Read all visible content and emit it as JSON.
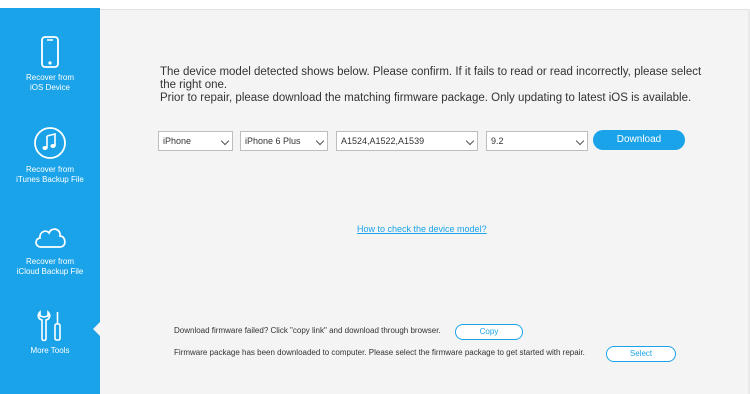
{
  "sidebar": {
    "items": [
      {
        "label_line1": "Recover from",
        "label_line2": "iOS Device",
        "icon": "phone-icon"
      },
      {
        "label_line1": "Recover from",
        "label_line2": "iTunes Backup File",
        "icon": "music-note-icon"
      },
      {
        "label_line1": "Recover from",
        "label_line2": "iCloud Backup File",
        "icon": "cloud-icon"
      },
      {
        "label_line1": "More Tools",
        "label_line2": "",
        "icon": "tools-icon"
      }
    ]
  },
  "main": {
    "instruction_line1": "The device model detected shows below. Please confirm. If it fails to read or read incorrectly, please select the right one.",
    "instruction_line2": "Prior to repair, please download the matching firmware package. Only updating to latest iOS is available.",
    "selects": {
      "device_type": "iPhone",
      "model": "iPhone 6 Plus",
      "model_number": "A1524,A1522,A1539",
      "ios_version": "9.2"
    },
    "download_label": "Download",
    "help_link": "How to check the device model?",
    "footer": {
      "failed_text": "Download firmware failed? Click \"copy link\" and download through browser.",
      "copy_label": "Copy",
      "downloaded_text": "Firmware package has been downloaded to computer. Please select the firmware package to get started with repair.",
      "select_label": "Select"
    }
  },
  "colors": {
    "accent": "#1aa3e8",
    "background": "#f4f4f4"
  }
}
